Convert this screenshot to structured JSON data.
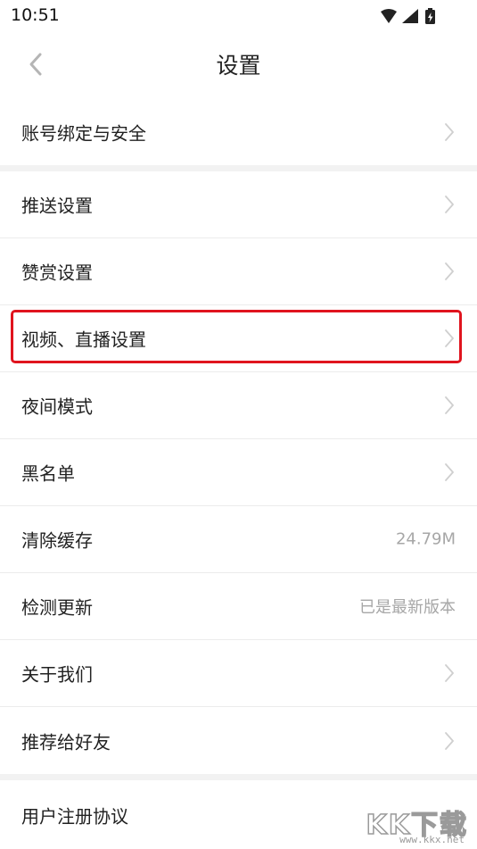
{
  "status_bar": {
    "time": "10:51",
    "icons": [
      "wifi-icon",
      "cellular-signal-icon",
      "battery-charging-icon"
    ]
  },
  "header": {
    "title": "设置",
    "back_icon": "chevron-left-icon"
  },
  "menu": {
    "account": {
      "label": "账号绑定与安全"
    },
    "items": [
      {
        "label": "推送设置"
      },
      {
        "label": "赞赏设置"
      },
      {
        "label": "视频、直播设置"
      },
      {
        "label": "夜间模式"
      },
      {
        "label": "黑名单"
      },
      {
        "label": "清除缓存",
        "value": "24.79M"
      },
      {
        "label": "检测更新",
        "value": "已是最新版本"
      },
      {
        "label": "关于我们"
      },
      {
        "label": "推荐给好友"
      }
    ],
    "agreement": {
      "label": "用户注册协议"
    }
  },
  "highlight": {
    "color": "#e0141e",
    "target": "视频、直播设置"
  },
  "watermark": {
    "text": "KK下载",
    "url": "www.kkx.net"
  },
  "colors": {
    "divider": "#ececec",
    "section_gap": "#f2f2f2",
    "chevron": "#cfcfcf",
    "secondary_text": "#a7a7a7"
  }
}
